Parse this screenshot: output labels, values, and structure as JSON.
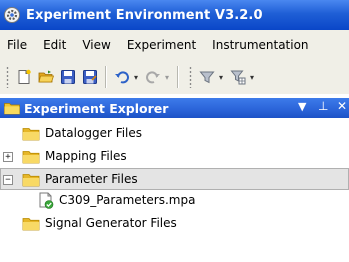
{
  "window": {
    "title": "Experiment Environment V3.2.0",
    "app_icon": "gear-app-icon"
  },
  "menu": {
    "items": [
      "File",
      "Edit",
      "View",
      "Experiment",
      "Instrumentation"
    ]
  },
  "toolbar": {
    "buttons": [
      "new-document-icon",
      "open-folder-icon",
      "save-icon",
      "save-as-icon",
      "undo-icon",
      "redo-icon",
      "filter-icon",
      "grid-filter-icon"
    ]
  },
  "explorer": {
    "title": "Experiment Explorer",
    "icon": "explorer-folder-icon",
    "controls": [
      "dropdown-arrow-icon",
      "pin-icon",
      "close-icon"
    ]
  },
  "tree": {
    "nodes": [
      {
        "label": "Datalogger Files",
        "expander": ""
      },
      {
        "label": "Mapping Files",
        "expander": "+"
      },
      {
        "label": "Parameter Files",
        "expander": "−",
        "selected": true
      },
      {
        "label": "C309_Parameters.mpa",
        "expander": ""
      },
      {
        "label": "Signal Generator Files",
        "expander": ""
      }
    ]
  },
  "colors": {
    "title_bar": "#1f5fd6",
    "menu_bg": "#f0efe7",
    "folder": "#f2c530",
    "selection": "#e4e4e4"
  }
}
